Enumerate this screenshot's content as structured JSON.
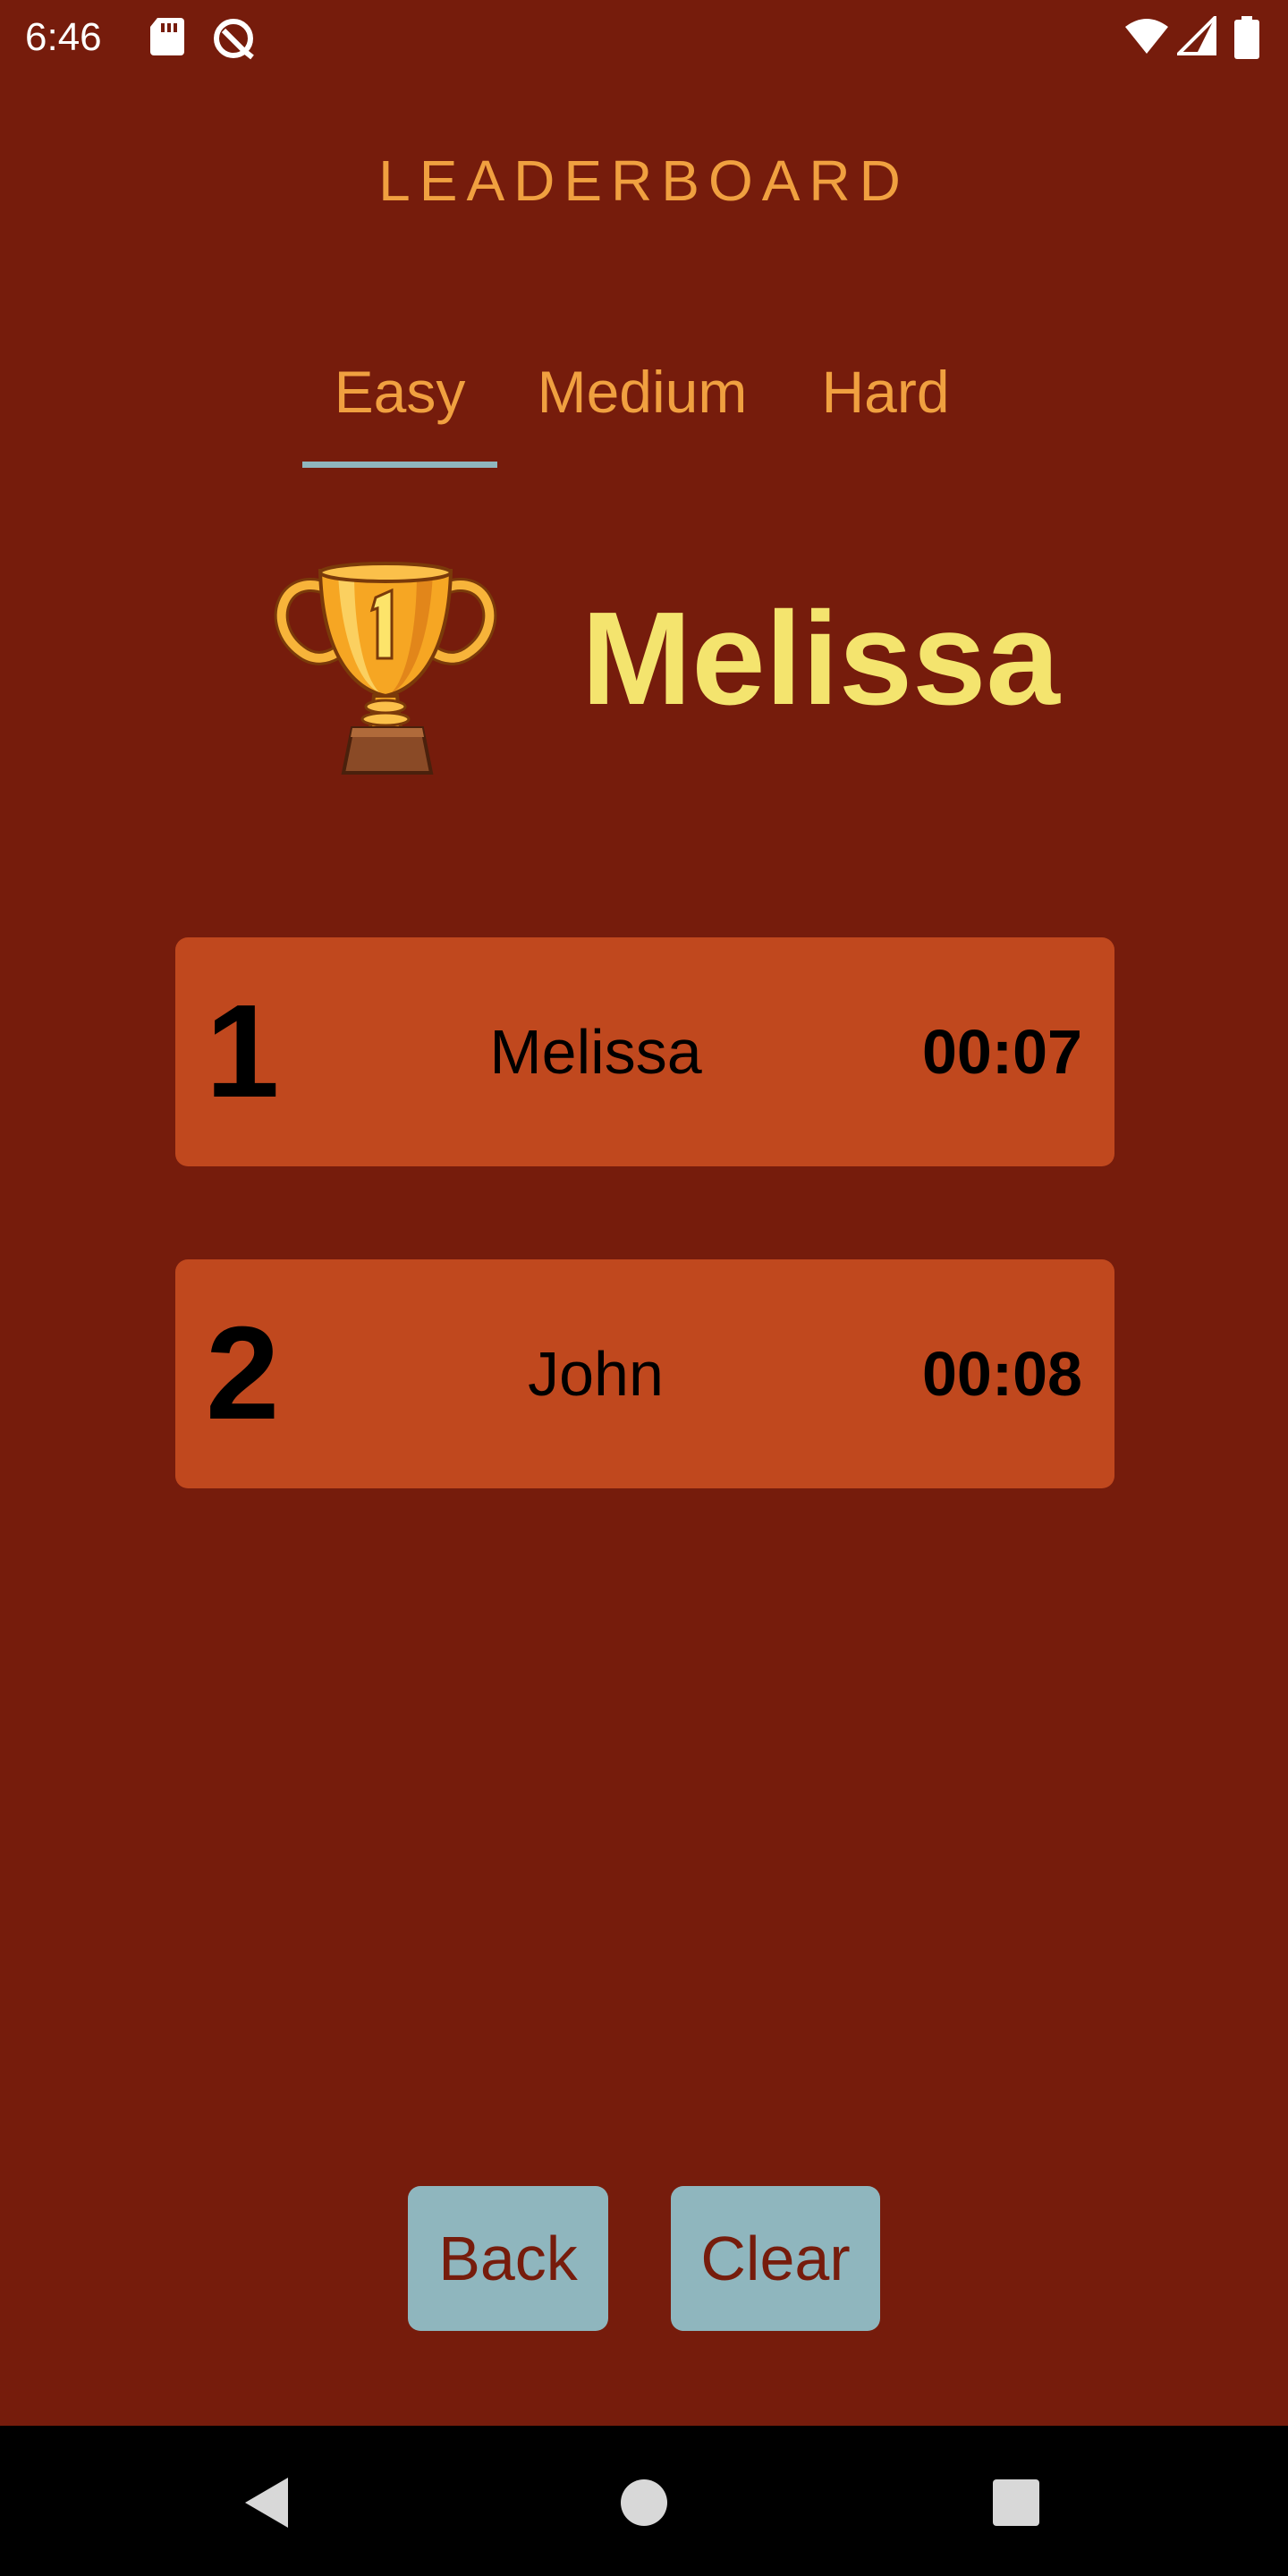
{
  "status_bar": {
    "time": "6:46",
    "icons": [
      "sd-card-icon",
      "data-saver-icon",
      "wifi-icon",
      "cell-signal-icon",
      "battery-icon"
    ]
  },
  "header": {
    "title": "LEADERBOARD"
  },
  "tabs": [
    {
      "label": "Easy",
      "selected": true
    },
    {
      "label": "Medium",
      "selected": false
    },
    {
      "label": "Hard",
      "selected": false
    }
  ],
  "winner": {
    "name": "Melissa",
    "trophy_number": "1"
  },
  "entries": [
    {
      "rank": "1",
      "name": "Melissa",
      "time": "00:07"
    },
    {
      "rank": "2",
      "name": "John",
      "time": "00:08"
    }
  ],
  "buttons": {
    "back": "Back",
    "clear": "Clear"
  },
  "nav_bar": {
    "icons": [
      "back-icon",
      "home-icon",
      "recents-icon"
    ]
  },
  "colors": {
    "background": "#761c0c",
    "accent": "#f0a040",
    "winner_name": "#f4e46e",
    "row": "#c0481e",
    "button": "#8fb6be"
  }
}
